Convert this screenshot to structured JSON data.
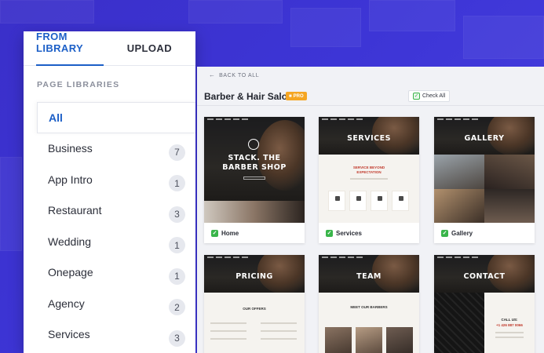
{
  "tabs": [
    {
      "label": "FROM LIBRARY",
      "active": true
    },
    {
      "label": "UPLOAD",
      "active": false
    }
  ],
  "section_label": "PAGE LIBRARIES",
  "libraries": [
    {
      "label": "All",
      "count": "",
      "active": true
    },
    {
      "label": "Business",
      "count": "7"
    },
    {
      "label": "App Intro",
      "count": "1"
    },
    {
      "label": "Restaurant",
      "count": "3"
    },
    {
      "label": "Wedding",
      "count": "1"
    },
    {
      "label": "Onepage",
      "count": "1"
    },
    {
      "label": "Agency",
      "count": "2"
    },
    {
      "label": "Services",
      "count": "3"
    }
  ],
  "panel": {
    "back_label": "BACK TO ALL",
    "title": "Barber & Hair Salon",
    "pro_label": "PRO",
    "check_all_label": "Check All"
  },
  "templates": [
    {
      "name": "Home",
      "hero_text_1": "STACK. THE",
      "hero_text_2": "BARBER SHOP",
      "checked": true
    },
    {
      "name": "Services",
      "hero_text_1": "SERVICES",
      "hero_text_2": "",
      "sub_1": "SERVICE BEYOND",
      "sub_2": "EXPECTATION",
      "checked": true
    },
    {
      "name": "Gallery",
      "hero_text_1": "GALLERY",
      "hero_text_2": "",
      "checked": true
    },
    {
      "name": "Pricing",
      "hero_text_1": "PRICING",
      "hero_text_2": "",
      "sub_1": "OUR OFFERS",
      "checked": true
    },
    {
      "name": "Team",
      "hero_text_1": "TEAM",
      "hero_text_2": "",
      "sub_1": "MEET OUR BARBERS",
      "checked": true
    },
    {
      "name": "Contact",
      "hero_text_1": "CONTACT",
      "hero_text_2": "",
      "sub_1": "CALL US:",
      "sub_2": "+1 426 887 0066",
      "checked": true
    }
  ],
  "colors": {
    "background": "#3d35d6",
    "accent": "#1c5fc7",
    "check_green": "#39b54a",
    "pro_orange": "#f5a623"
  }
}
